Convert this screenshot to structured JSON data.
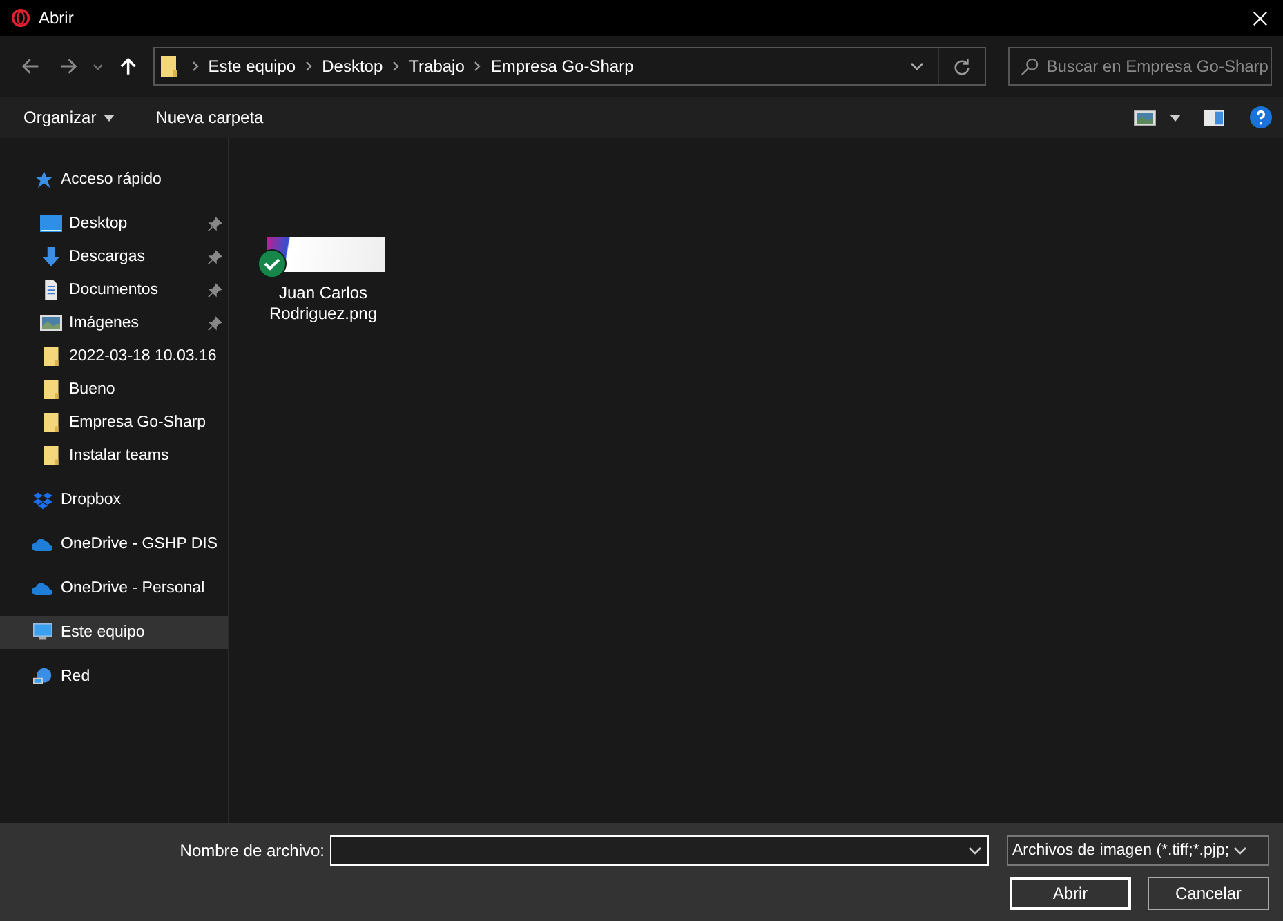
{
  "window": {
    "title": "Abrir"
  },
  "breadcrumb": [
    "Este equipo",
    "Desktop",
    "Trabajo",
    "Empresa Go-Sharp"
  ],
  "search": {
    "placeholder": "Buscar en Empresa Go-Sharp"
  },
  "toolbar": {
    "organize": "Organizar",
    "new_folder": "Nueva carpeta"
  },
  "sidebar": {
    "items": [
      {
        "label": "Acceso rápido",
        "kind": "quick",
        "selected": false,
        "children": [
          {
            "label": "Desktop",
            "kind": "desktop",
            "pinned": true
          },
          {
            "label": "Descargas",
            "kind": "downloads",
            "pinned": true
          },
          {
            "label": "Documentos",
            "kind": "documents",
            "pinned": true
          },
          {
            "label": "Imágenes",
            "kind": "pictures",
            "pinned": true
          },
          {
            "label": "2022-03-18 10.03.16",
            "kind": "folder",
            "pinned": false
          },
          {
            "label": "Bueno",
            "kind": "folder",
            "pinned": false
          },
          {
            "label": "Empresa Go-Sharp",
            "kind": "folder",
            "pinned": false
          },
          {
            "label": "Instalar teams",
            "kind": "folder",
            "pinned": false
          }
        ]
      },
      {
        "label": "Dropbox",
        "kind": "dropbox",
        "selected": false
      },
      {
        "label": "OneDrive - GSHP DIS",
        "kind": "onedrive",
        "selected": false
      },
      {
        "label": "OneDrive - Personal",
        "kind": "onedrive",
        "selected": false
      },
      {
        "label": "Este equipo",
        "kind": "pc",
        "selected": true
      },
      {
        "label": "Red",
        "kind": "network",
        "selected": false
      }
    ]
  },
  "files": [
    {
      "name": "Juan Carlos Rodriguez.png",
      "synced": true
    }
  ],
  "footer": {
    "filename_label": "Nombre de archivo:",
    "filter": "Archivos de imagen (*.tiff;*.pjp;",
    "buttons": [
      "Abrir",
      "Cancelar"
    ]
  }
}
